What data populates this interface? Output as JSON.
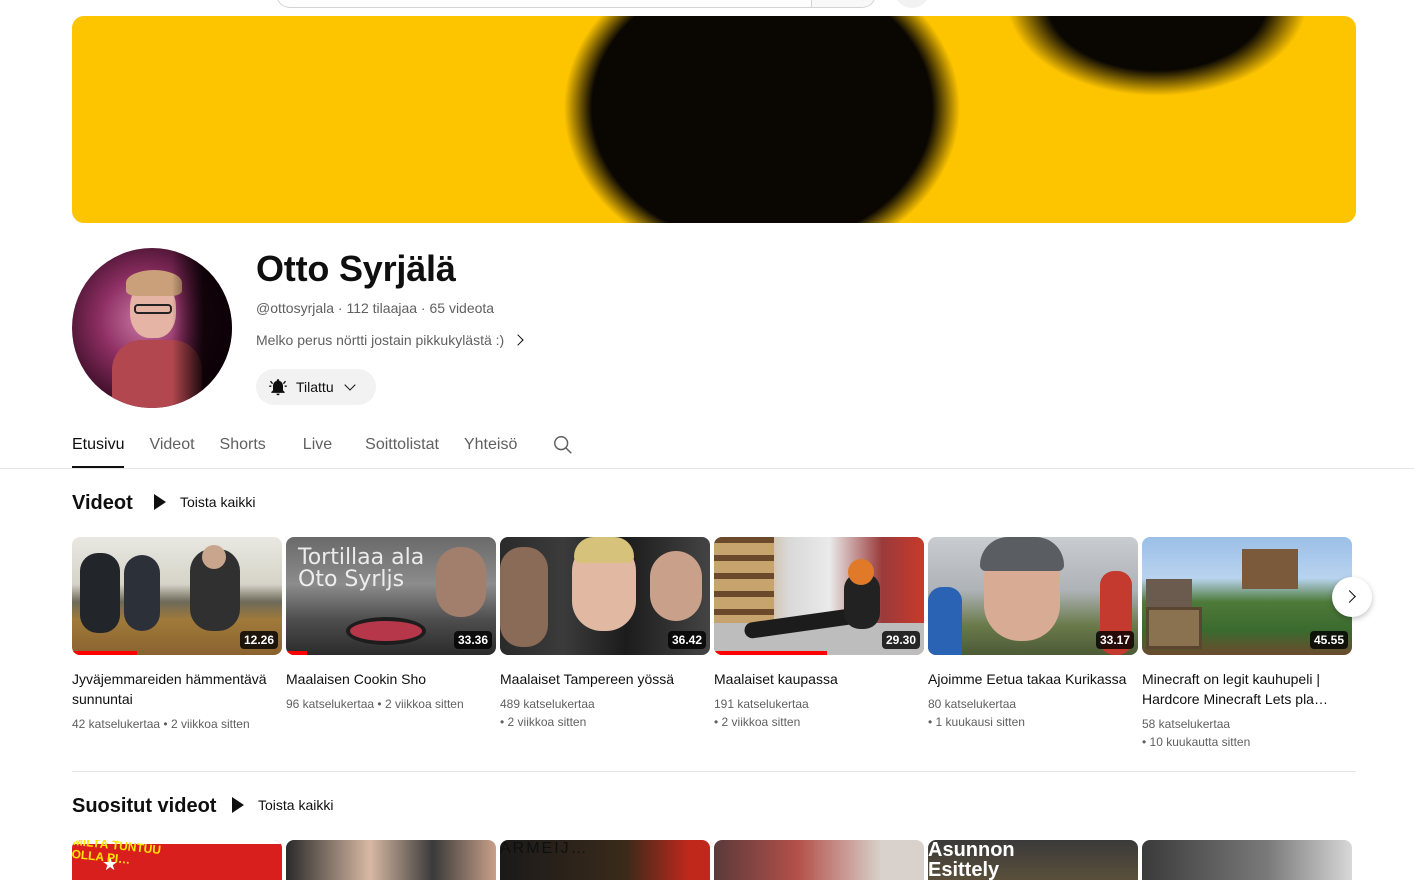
{
  "channel": {
    "name": "Otto Syrjälä",
    "meta": "@ottosyrjala · 112 tilaajaa · 65 videota",
    "description": "Melko perus nörtti jostain pikkukylästä :)",
    "subscribe_label": "Tilattu"
  },
  "tabs": [
    {
      "label": "Etusivu",
      "active": true
    },
    {
      "label": "Videot"
    },
    {
      "label": "Shorts"
    },
    {
      "label": "Live"
    },
    {
      "label": "Soittolistat"
    },
    {
      "label": "Yhteisö"
    }
  ],
  "sections": {
    "videos": {
      "title": "Videot",
      "play_all": "Toista kaikki"
    },
    "popular": {
      "title": "Suositut videot",
      "play_all": "Toista kaikki"
    }
  },
  "videos": [
    {
      "title": "Jyväjemmareiden hämmentävä sunnuntai",
      "views": "42 katselukertaa",
      "age": "2 viikkoa sitten",
      "duration": "12.26",
      "progress": 0.31
    },
    {
      "title": "Maalaisen Cookin Sho",
      "views": "96 katselukertaa",
      "age": "2 viikkoa sitten",
      "duration": "33.36",
      "progress": 0.1,
      "overlay_text": "Tortillaa ala Oto Syrljs"
    },
    {
      "title": "Maalaiset Tampereen yössä",
      "views": "489 katselukertaa",
      "age": "2 viikkoa sitten",
      "duration": "36.42"
    },
    {
      "title": "Maalaiset kaupassa",
      "views": "191 katselukertaa",
      "age": "2 viikkoa sitten",
      "duration": "29.30",
      "progress": 0.54
    },
    {
      "title": "Ajoimme Eetua takaa Kurikassa",
      "views": "80 katselukertaa",
      "age": "1 kuukausi sitten",
      "duration": "33.17"
    },
    {
      "title": "Minecraft on legit kauhupeli | Hardcore Minecraft Lets pla…",
      "views": "58 katselukertaa",
      "age": "10 kuukautta sitten",
      "duration": "45.55"
    }
  ],
  "popular_thumbs": [
    {
      "overlay_text": "MILTÄ TUNTUU OLLA PI…"
    },
    {},
    {
      "overlay_text": "ARMEIJ…"
    },
    {},
    {
      "overlay_text": "Asunnon Esittely"
    },
    {}
  ],
  "colors": {
    "accent": "#ff0000",
    "banner_yellow": "#fdc400",
    "banner_dark": "#0a0703"
  }
}
